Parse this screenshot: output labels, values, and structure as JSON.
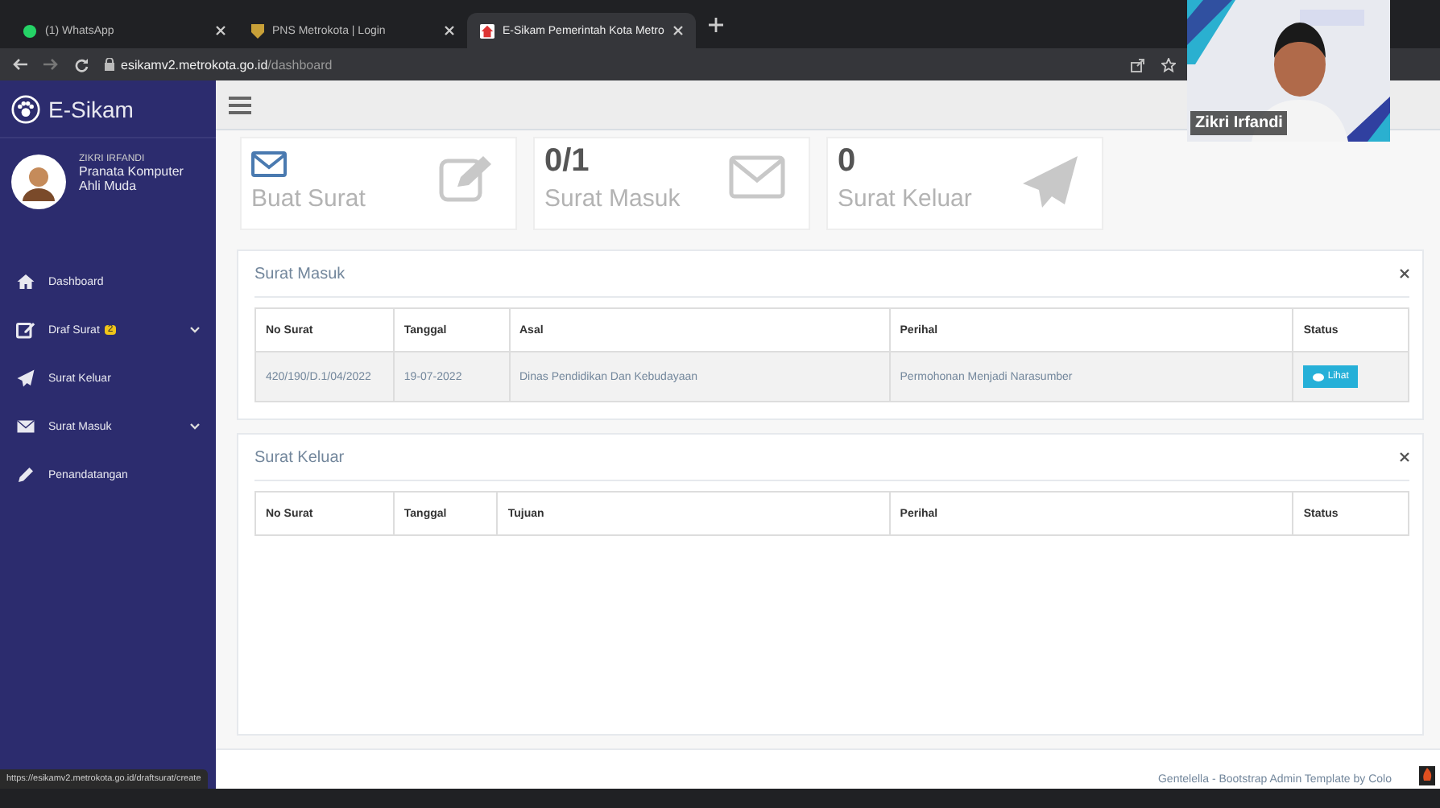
{
  "browser": {
    "tabs": [
      {
        "title": "(1) WhatsApp",
        "selected": false
      },
      {
        "title": "PNS Metrokota | Login",
        "selected": false
      },
      {
        "title": "E-Sikam Pemerintah Kota Metro",
        "selected": true
      }
    ],
    "url_host": "esikamv2.metrokota.go.id",
    "url_path": "/dashboard",
    "status_url": "https://esikamv2.metrokota.go.id/draftsurat/create"
  },
  "sidebar": {
    "brand": "E-Sikam",
    "user_name": "ZIKRI IRFANDI",
    "user_role": "Pranata Komputer Ahli Muda",
    "items": [
      {
        "label": "Dashboard",
        "expandable": false
      },
      {
        "label": "Draf Surat",
        "badge": "2",
        "expandable": true
      },
      {
        "label": "Surat Keluar",
        "expandable": false
      },
      {
        "label": "Surat Masuk",
        "expandable": true
      },
      {
        "label": "Penandatangan",
        "expandable": false
      }
    ]
  },
  "stats": [
    {
      "label": "Buat Surat"
    },
    {
      "value": "0/1",
      "label": "Surat Masuk"
    },
    {
      "value": "0",
      "label": "Surat Keluar"
    }
  ],
  "panels": [
    {
      "title": "Surat Masuk",
      "columns": [
        "No Surat",
        "Tanggal",
        "Asal",
        "Perihal",
        "Status"
      ],
      "rows": [
        {
          "cells": [
            "420/190/D.1/04/2022",
            "19-07-2022",
            "Dinas Pendidikan Dan Kebudayaan",
            "Permohonan Menjadi Narasumber"
          ],
          "action": "Lihat"
        }
      ]
    },
    {
      "title": "Surat Keluar",
      "columns": [
        "No Surat",
        "Tanggal",
        "Tujuan",
        "Perihal",
        "Status"
      ]
    }
  ],
  "footer": "Gentelella - Bootstrap Admin Template by Colo",
  "video": {
    "participant": "Zikri Irfandi"
  }
}
